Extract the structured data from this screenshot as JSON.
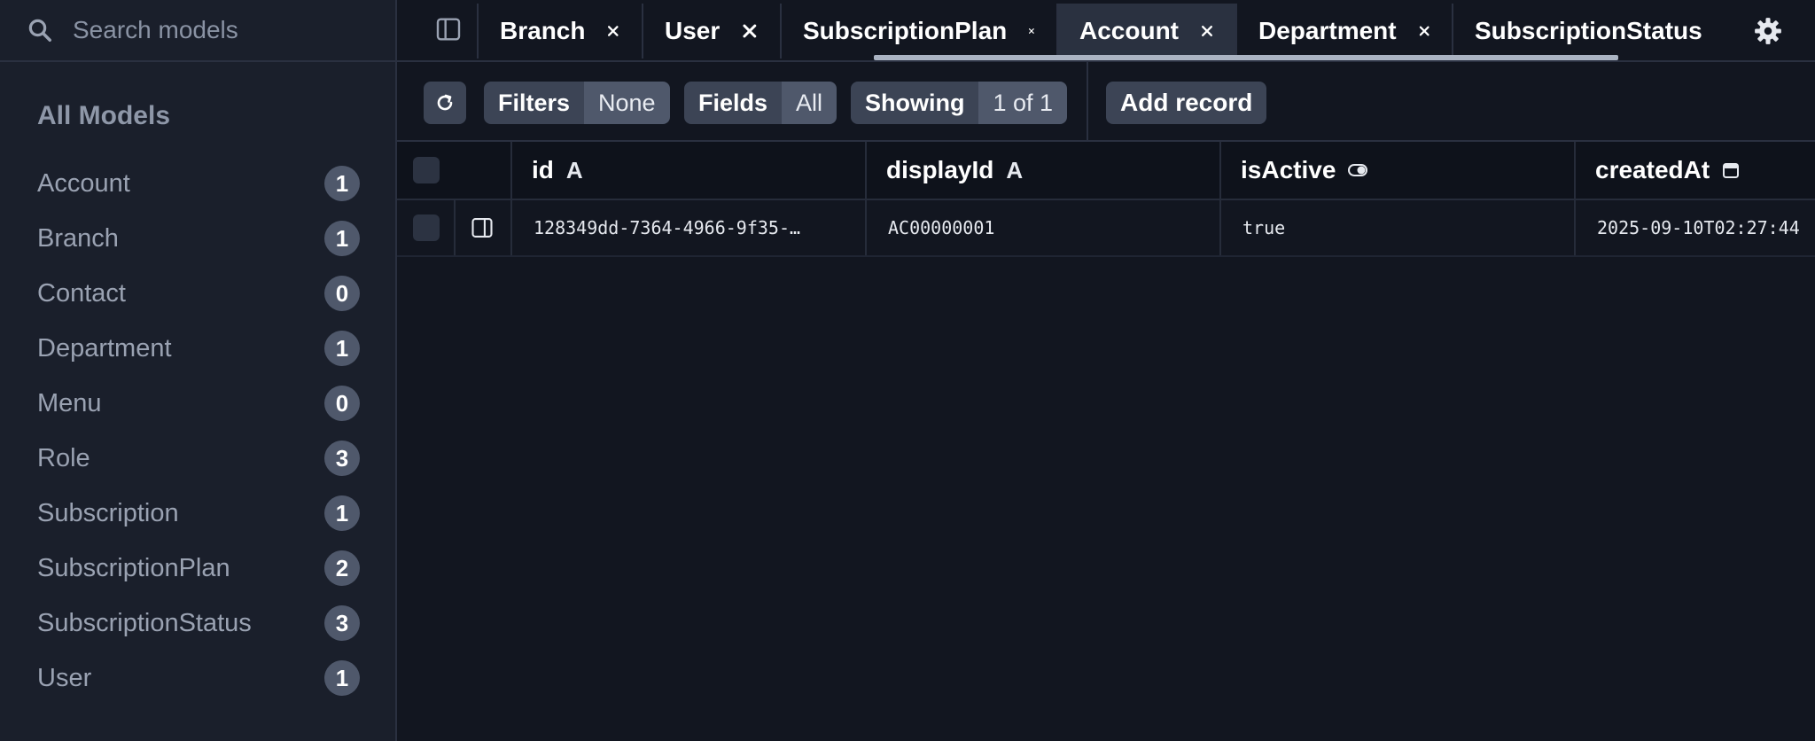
{
  "search": {
    "placeholder": "Search models"
  },
  "sidebar": {
    "title": "All Models",
    "items": [
      {
        "label": "Account",
        "count": "1"
      },
      {
        "label": "Branch",
        "count": "1"
      },
      {
        "label": "Contact",
        "count": "0"
      },
      {
        "label": "Department",
        "count": "1"
      },
      {
        "label": "Menu",
        "count": "0"
      },
      {
        "label": "Role",
        "count": "3"
      },
      {
        "label": "Subscription",
        "count": "1"
      },
      {
        "label": "SubscriptionPlan",
        "count": "2"
      },
      {
        "label": "SubscriptionStatus",
        "count": "3"
      },
      {
        "label": "User",
        "count": "1"
      }
    ]
  },
  "tabs": [
    {
      "label": "Branch"
    },
    {
      "label": "User"
    },
    {
      "label": "SubscriptionPlan"
    },
    {
      "label": "Account",
      "active": true
    },
    {
      "label": "Department"
    },
    {
      "label": "SubscriptionStatus"
    }
  ],
  "toolbar": {
    "filters_label": "Filters",
    "filters_value": "None",
    "fields_label": "Fields",
    "fields_value": "All",
    "showing_label": "Showing",
    "showing_value": "1 of 1",
    "add_label": "Add record"
  },
  "grid": {
    "columns": [
      {
        "name": "id",
        "type_icon": "A"
      },
      {
        "name": "displayId",
        "type_icon": "A"
      },
      {
        "name": "isActive",
        "type_icon": "toggle-icon"
      },
      {
        "name": "createdAt",
        "type_icon": "calendar-icon"
      }
    ],
    "rows": [
      {
        "id": "128349dd-7364-4966-9f35-…",
        "displayId": "AC00000001",
        "isActive": "true",
        "createdAt": "2025-09-10T02:27:44"
      }
    ]
  }
}
